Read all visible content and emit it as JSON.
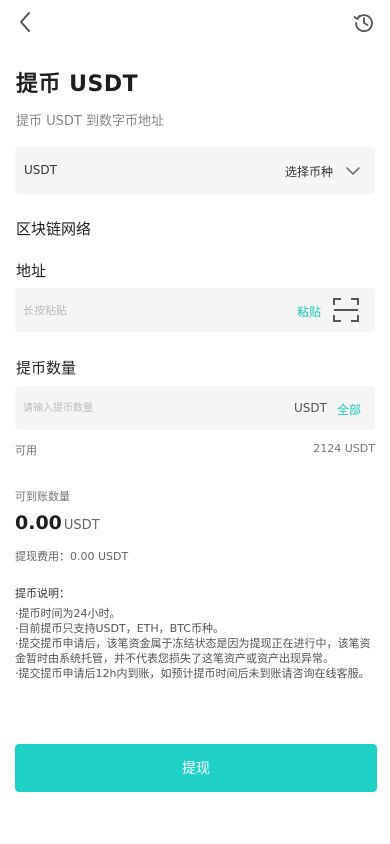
{
  "header": {
    "back_icon": "chevron-left-icon",
    "history_icon": "history-clock-icon"
  },
  "page": {
    "title": "提币 USDT",
    "subtitle": "提币 USDT 到数字币地址"
  },
  "coin_select": {
    "coin": "USDT",
    "choose_label": "选择币种",
    "icon": "chevron-down-icon"
  },
  "network": {
    "label": "区块链网络"
  },
  "address": {
    "label": "地址",
    "placeholder": "长按粘贴",
    "value": "",
    "paste_label": "粘贴",
    "scan_icon": "scan-icon"
  },
  "amount": {
    "label": "提币数量",
    "placeholder": "请输入提币数量",
    "value": "",
    "unit": "USDT",
    "all_label": "全部"
  },
  "available": {
    "label": "可用",
    "value": "2124 USDT"
  },
  "receive": {
    "label": "可到账数量",
    "amount": "0.00",
    "unit": "USDT",
    "fee": "提现费用：0.00 USDT"
  },
  "notes": {
    "title": "提币说明：",
    "lines": [
      "·提币时间为24小时。",
      "·目前提币只支持USDT，ETH，BTC币种。",
      "·提交提币申请后，该笔资金属于冻结状态是因为提现正在进行中，该笔资金暂时由系统托管，并不代表您损失了这笔资产或资产出现异常。",
      "·提交提币申请后12h内到账，如预计提币时间后未到账请咨询在线客服。"
    ]
  },
  "submit": {
    "label": "提现"
  },
  "colors": {
    "accent": "#1fd1c6",
    "link": "#1ec9bc",
    "field_bg": "#f5f5f5"
  }
}
